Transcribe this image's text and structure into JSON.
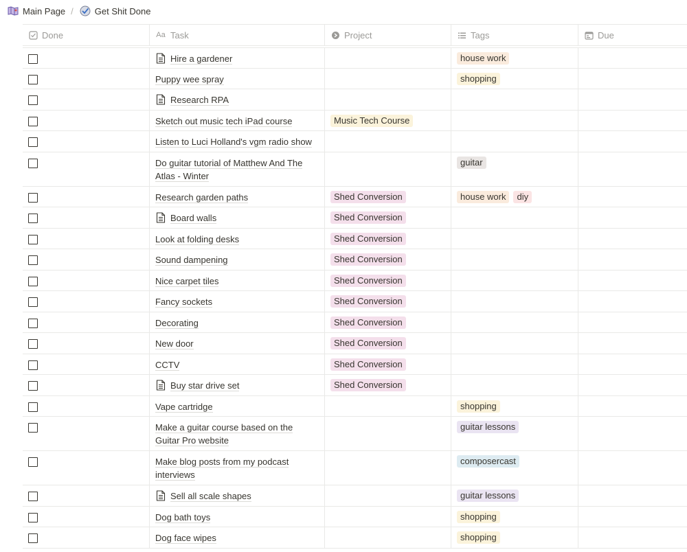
{
  "breadcrumb": {
    "items": [
      {
        "label": "Main Page",
        "icon": "map-icon"
      },
      {
        "label": "Get Shit Done",
        "icon": "checkmark-circle-icon"
      }
    ],
    "separator": "/"
  },
  "columns": [
    {
      "key": "done",
      "label": "Done",
      "icon": "checkbox-icon"
    },
    {
      "key": "task",
      "label": "Task",
      "icon": "title-aa-icon"
    },
    {
      "key": "project",
      "label": "Project",
      "icon": "relation-icon"
    },
    {
      "key": "tags",
      "label": "Tags",
      "icon": "list-icon"
    },
    {
      "key": "due",
      "label": "Due",
      "icon": "calendar-icon"
    }
  ],
  "rows": [
    {
      "task": "Hire a gardener",
      "page_icon": true,
      "project": "",
      "tags": [
        {
          "label": "house work",
          "cls": "t-housework"
        }
      ],
      "height": 30
    },
    {
      "task": "Puppy wee spray",
      "page_icon": false,
      "project": "",
      "tags": [
        {
          "label": "shopping",
          "cls": "t-shopping"
        }
      ],
      "height": 30
    },
    {
      "task": "Research RPA",
      "page_icon": true,
      "project": "",
      "tags": [],
      "height": 31
    },
    {
      "task": "Sketch out music tech iPad course",
      "page_icon": false,
      "project": "Music Tech Course",
      "project_cls": "p-music",
      "tags": [],
      "height": 30
    },
    {
      "task": "Listen to Luci Holland's vgm radio show",
      "page_icon": false,
      "project": "",
      "tags": [],
      "height": 31
    },
    {
      "task": "Do guitar tutorial of Matthew And The Atlas - Winter",
      "page_icon": false,
      "project": "",
      "tags": [
        {
          "label": "guitar",
          "cls": "t-guitar"
        }
      ],
      "height": 50
    },
    {
      "task": "Research garden paths",
      "page_icon": false,
      "project": "Shed Conversion",
      "project_cls": "p-shed",
      "tags": [
        {
          "label": "house work",
          "cls": "t-housework"
        },
        {
          "label": "diy",
          "cls": "t-diy"
        }
      ],
      "height": 30
    },
    {
      "task": "Board walls",
      "page_icon": true,
      "project": "Shed Conversion",
      "project_cls": "p-shed",
      "tags": [],
      "height": 31
    },
    {
      "task": "Look at folding desks",
      "page_icon": false,
      "project": "Shed Conversion",
      "project_cls": "p-shed",
      "tags": [],
      "height": 30
    },
    {
      "task": "Sound dampening",
      "page_icon": false,
      "project": "Shed Conversion",
      "project_cls": "p-shed",
      "tags": [],
      "height": 31
    },
    {
      "task": "Nice carpet tiles",
      "page_icon": false,
      "project": "Shed Conversion",
      "project_cls": "p-shed",
      "tags": [],
      "height": 30
    },
    {
      "task": "Fancy sockets",
      "page_icon": false,
      "project": "Shed Conversion",
      "project_cls": "p-shed",
      "tags": [],
      "height": 31
    },
    {
      "task": "Decorating",
      "page_icon": false,
      "project": "Shed Conversion",
      "project_cls": "p-shed",
      "tags": [],
      "height": 30
    },
    {
      "task": "New door",
      "page_icon": false,
      "project": "Shed Conversion",
      "project_cls": "p-shed",
      "tags": [],
      "height": 31
    },
    {
      "task": "CCTV",
      "page_icon": false,
      "project": "Shed Conversion",
      "project_cls": "p-shed",
      "tags": [],
      "height": 30
    },
    {
      "task": "Buy star drive set",
      "page_icon": true,
      "project": "Shed Conversion",
      "project_cls": "p-shed",
      "tags": [],
      "height": 31
    },
    {
      "task": "Vape cartridge",
      "page_icon": false,
      "project": "",
      "tags": [
        {
          "label": "shopping",
          "cls": "t-shopping"
        }
      ],
      "height": 30
    },
    {
      "task": "Make a guitar course based on the Guitar Pro website",
      "page_icon": false,
      "project": "",
      "tags": [
        {
          "label": "guitar lessons",
          "cls": "t-guitarlessons"
        }
      ],
      "height": 50
    },
    {
      "task": "Make blog posts from my podcast interviews",
      "page_icon": false,
      "project": "",
      "tags": [
        {
          "label": "composercast",
          "cls": "t-composercast"
        }
      ],
      "height": 50
    },
    {
      "task": "Sell all scale shapes",
      "page_icon": true,
      "project": "",
      "tags": [
        {
          "label": "guitar lessons",
          "cls": "t-guitarlessons"
        }
      ],
      "height": 31
    },
    {
      "task": "Dog bath toys",
      "page_icon": false,
      "project": "",
      "tags": [
        {
          "label": "shopping",
          "cls": "t-shopping"
        }
      ],
      "height": 30
    },
    {
      "task": "Dog face wipes",
      "page_icon": false,
      "project": "",
      "tags": [
        {
          "label": "shopping",
          "cls": "t-shopping"
        }
      ],
      "height": 31
    }
  ]
}
